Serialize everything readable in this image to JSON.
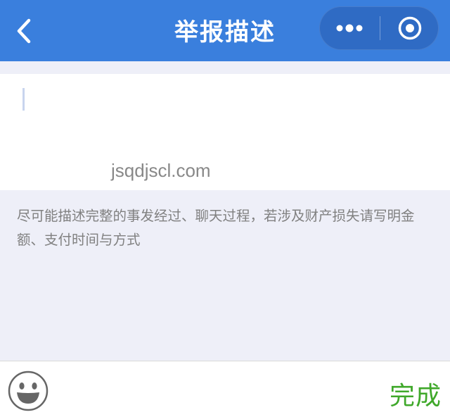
{
  "header": {
    "title": "举报描述",
    "back_icon": "chevron-left-icon",
    "more_icon": "more-dots-icon",
    "close_icon": "target-circle-icon",
    "background_color": "#3a7fdd"
  },
  "editor": {
    "value": "",
    "watermark": "jsqdjscl.com"
  },
  "hint": {
    "text": "尽可能描述完整的事发经过、聊天过程，若涉及财产损失请写明金额、支付时间与方式"
  },
  "toolbar": {
    "emoji_icon": "emoji-smile-icon",
    "done_label": "完成",
    "done_color": "#3fa82a"
  }
}
